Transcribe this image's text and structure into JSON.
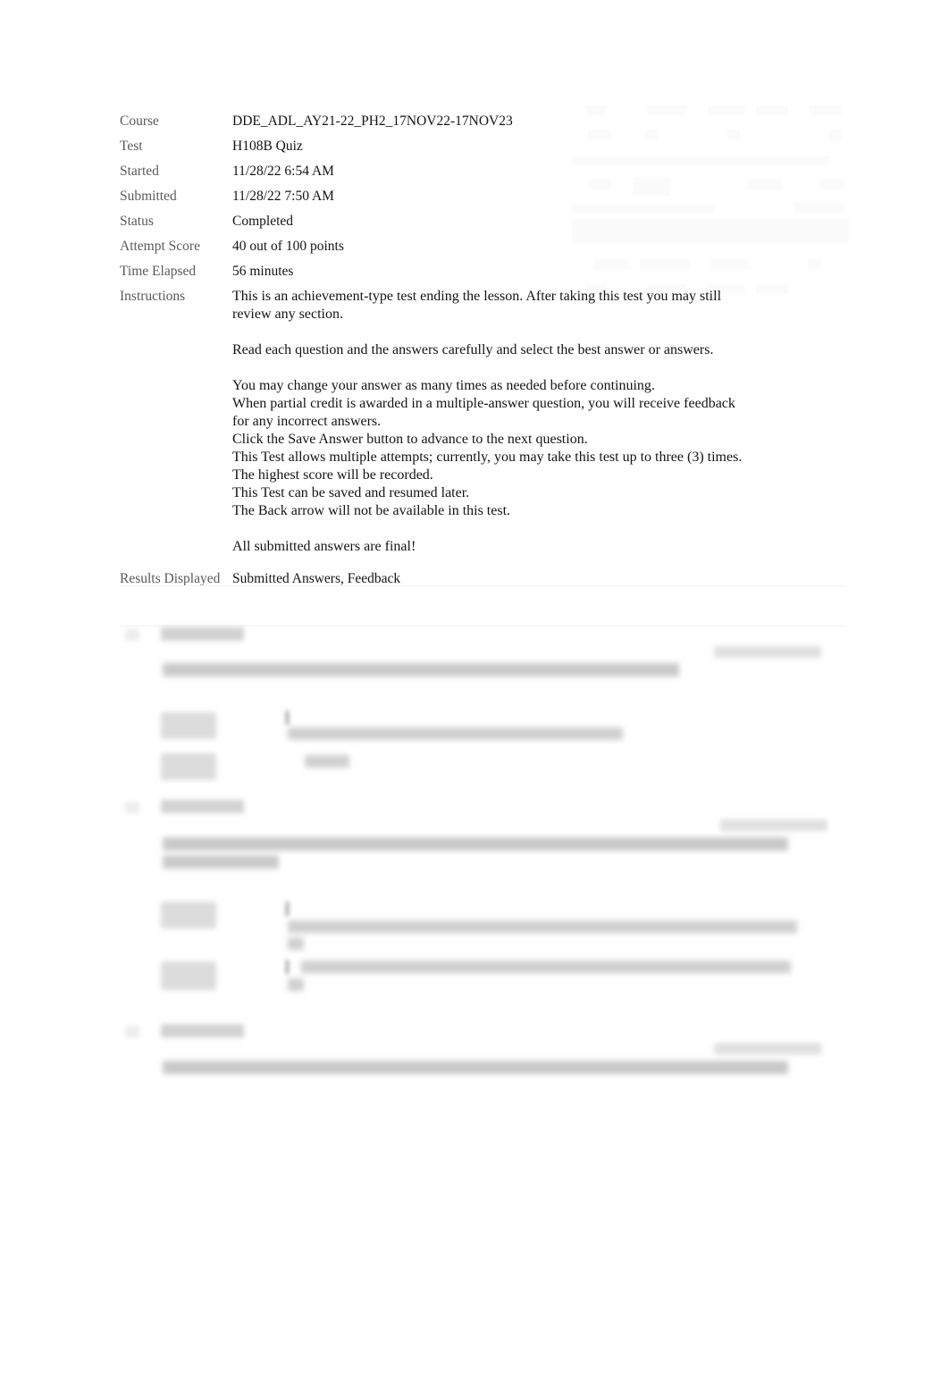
{
  "document": {
    "type": "test-review",
    "background_color": "#ffffff",
    "text_color": "#141414",
    "label_color": "#5a5a5a"
  },
  "summary": {
    "rows": [
      {
        "label": "Course",
        "value": "DDE_ADL_AY21-22_PH2_17NOV22-17NOV23"
      },
      {
        "label": "Test",
        "value": "H108B Quiz"
      },
      {
        "label": "Started",
        "value": "11/28/22 6:54 AM"
      },
      {
        "label": "Submitted",
        "value": "11/28/22 7:50 AM"
      },
      {
        "label": "Status",
        "value": "Completed"
      },
      {
        "label": "Attempt Score",
        "value": "40 out of 100 points"
      },
      {
        "label": "Time Elapsed",
        "value": "56 minutes"
      }
    ],
    "attempt_score": {
      "points_earned": 40,
      "points_possible": 100,
      "text": "40 out of 100 points"
    },
    "time_elapsed_minutes": 56,
    "status": "Completed"
  },
  "instructions": {
    "label": "Instructions",
    "paragraphs": [
      "This is an achievement-type test ending the lesson. After taking this test you may still review any section.",
      "Read each question and the answers carefully and select the best answer or answers.",
      "You may change your answer as many times as needed before continuing.\nWhen partial credit is awarded in a multiple-answer question, you will receive feedback for any incorrect answers.\nClick the Save Answer button to advance to the next question.\nThis Test allows multiple attempts; currently, you may take this test up to three (3) times.\nThe highest score will be recorded.\nThis Test can be saved and resumed later.\nThe Back arrow will not be available in this test.",
      "All submitted answers are final!"
    ],
    "lines": {
      "p1_l1": "This is an achievement-type test ending the lesson. After taking this test you may still",
      "p1_l2": "review any section.",
      "p2_l1": "Read each question and the answers carefully and select the best answer or answers.",
      "p3_l1": "You may change your answer as many times as needed before continuing.",
      "p3_l2": "When partial credit is awarded in a multiple-answer question, you will receive feedback",
      "p3_l3": "for any incorrect answers.",
      "p3_l4": "Click the Save Answer button to advance to the next question.",
      "p3_l5": "This Test allows multiple attempts; currently, you may take this test up to three (3) times.",
      "p3_l6": "The highest score will be recorded.",
      "p3_l7": "This Test can be saved and resumed later.",
      "p3_l8": "The Back arrow will not be available in this test.",
      "p4_l1": "All submitted answers are final!"
    }
  },
  "results_displayed": {
    "label": "Results Displayed",
    "value": "Submitted Answers, Feedback"
  },
  "questions": {
    "redacted": true,
    "redaction_note": "Question text, answer choices and point values are blurred and unreadable in the source image.",
    "items": [
      {
        "index": 1,
        "heading_redacted": true,
        "points_redacted": true,
        "text_line_count": 1,
        "answers": [
          {
            "label_redacted": true,
            "line_count": 2
          },
          {
            "label_redacted": true,
            "line_count": 1
          }
        ]
      },
      {
        "index": 2,
        "heading_redacted": true,
        "points_redacted": true,
        "text_line_count": 2,
        "answers": [
          {
            "label_redacted": true,
            "line_count": 2
          },
          {
            "label_redacted": true,
            "line_count": 2
          }
        ]
      },
      {
        "index": 3,
        "heading_redacted": true,
        "points_redacted": true,
        "text_line_count": 1,
        "answers": []
      }
    ]
  }
}
